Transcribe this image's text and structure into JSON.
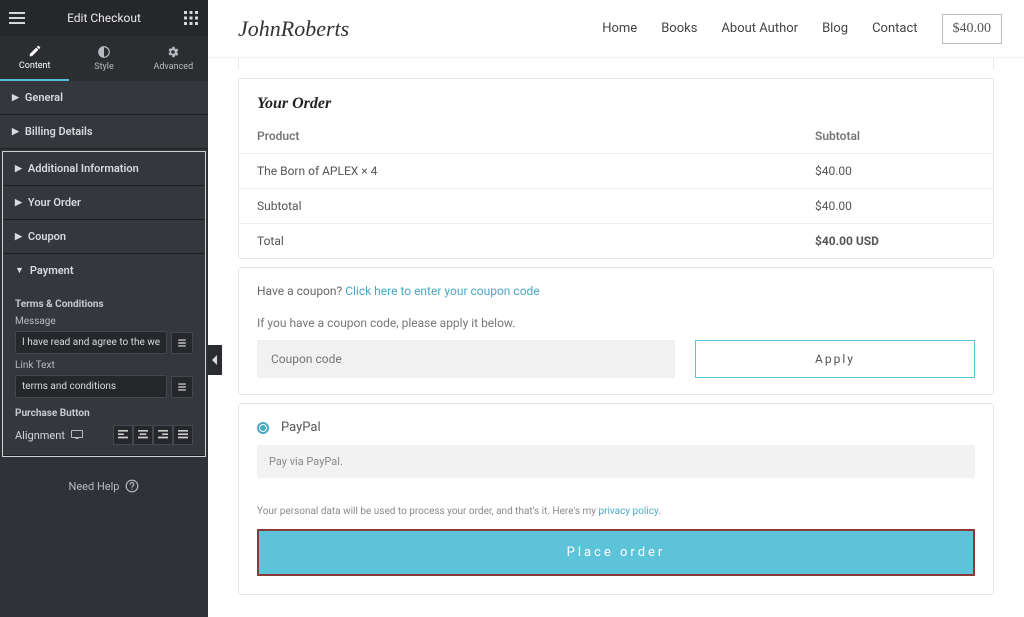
{
  "sidebar": {
    "title": "Edit Checkout",
    "tabs": {
      "content": "Content",
      "style": "Style",
      "advanced": "Advanced"
    },
    "sections": {
      "general": "General",
      "billing": "Billing Details",
      "additional": "Additional Information",
      "your_order": "Your Order",
      "coupon": "Coupon",
      "payment": "Payment"
    },
    "terms_heading": "Terms & Conditions",
    "message_label": "Message",
    "message_value": "I have read and agree to the website",
    "linktext_label": "Link Text",
    "linktext_value": "terms and conditions",
    "purchase_heading": "Purchase Button",
    "alignment_label": "Alignment",
    "help": "Need Help"
  },
  "site": {
    "logo": "JohnRoberts",
    "nav": {
      "home": "Home",
      "books": "Books",
      "about": "About Author",
      "blog": "Blog",
      "contact": "Contact"
    },
    "cart": "$40.00"
  },
  "order": {
    "title": "Your Order",
    "col_product": "Product",
    "col_subtotal": "Subtotal",
    "item_name": "The Born of APLEX  × 4",
    "item_total": "$40.00",
    "subtotal_label": "Subtotal",
    "subtotal_value": "$40.00",
    "total_label": "Total",
    "total_value": "$40.00 USD"
  },
  "coupon": {
    "question": "Have a coupon? ",
    "link": "Click here to enter your coupon code",
    "hint": "If you have a coupon code, please apply it below.",
    "placeholder": "Coupon code",
    "apply": "Apply"
  },
  "payment": {
    "paypal": "PayPal",
    "paypal_desc": "Pay via PayPal.",
    "privacy_pre": "Your personal data will be used to process your order, and that's it. Here's my ",
    "privacy_link": "privacy policy",
    "place": "Place order"
  }
}
